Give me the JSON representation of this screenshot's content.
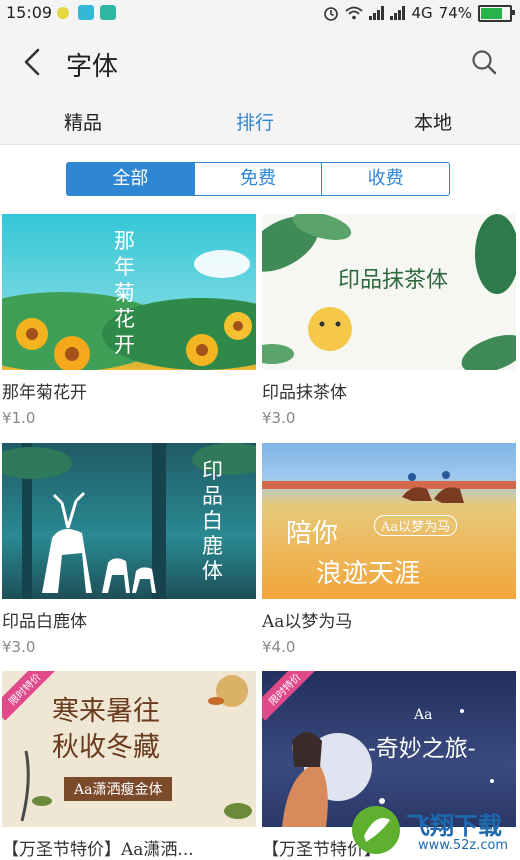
{
  "status_bar": {
    "time": "15:09",
    "network": "4G",
    "battery": "74%"
  },
  "header": {
    "title": "字体"
  },
  "tabs": [
    {
      "label": "精品",
      "active": false
    },
    {
      "label": "排行",
      "active": true
    },
    {
      "label": "本地",
      "active": false
    }
  ],
  "filter": {
    "options": [
      "全部",
      "免费",
      "收费"
    ],
    "selected": "全部"
  },
  "fonts": [
    {
      "name": "那年菊花开",
      "price": "¥1.0",
      "cover_text": "那年菊花开"
    },
    {
      "name": "印品抹茶体",
      "price": "¥3.0",
      "cover_text": "印品抹茶体"
    },
    {
      "name": "印品白鹿体",
      "price": "¥3.0",
      "cover_text": "印品白鹿体"
    },
    {
      "name": "Aa以梦为马",
      "price": "¥4.0",
      "cover_text_1": "陪你",
      "cover_text_2": "Aa以梦为马",
      "cover_text_3": "浪迹天涯"
    },
    {
      "name": "【万圣节特价】Aa潇洒...",
      "ribbon": "限时特价",
      "cover_text_1": "寒来暑往",
      "cover_text_2": "秋收冬藏",
      "cover_text_3": "Aa潇洒瘦金体"
    },
    {
      "name": "【万圣节特价】",
      "ribbon": "限时特价",
      "cover_text_1": "Aa",
      "cover_text_2": "-奇妙之旅-"
    }
  ],
  "watermark": {
    "text": "飞翔下载",
    "url": "www.52z.com"
  }
}
